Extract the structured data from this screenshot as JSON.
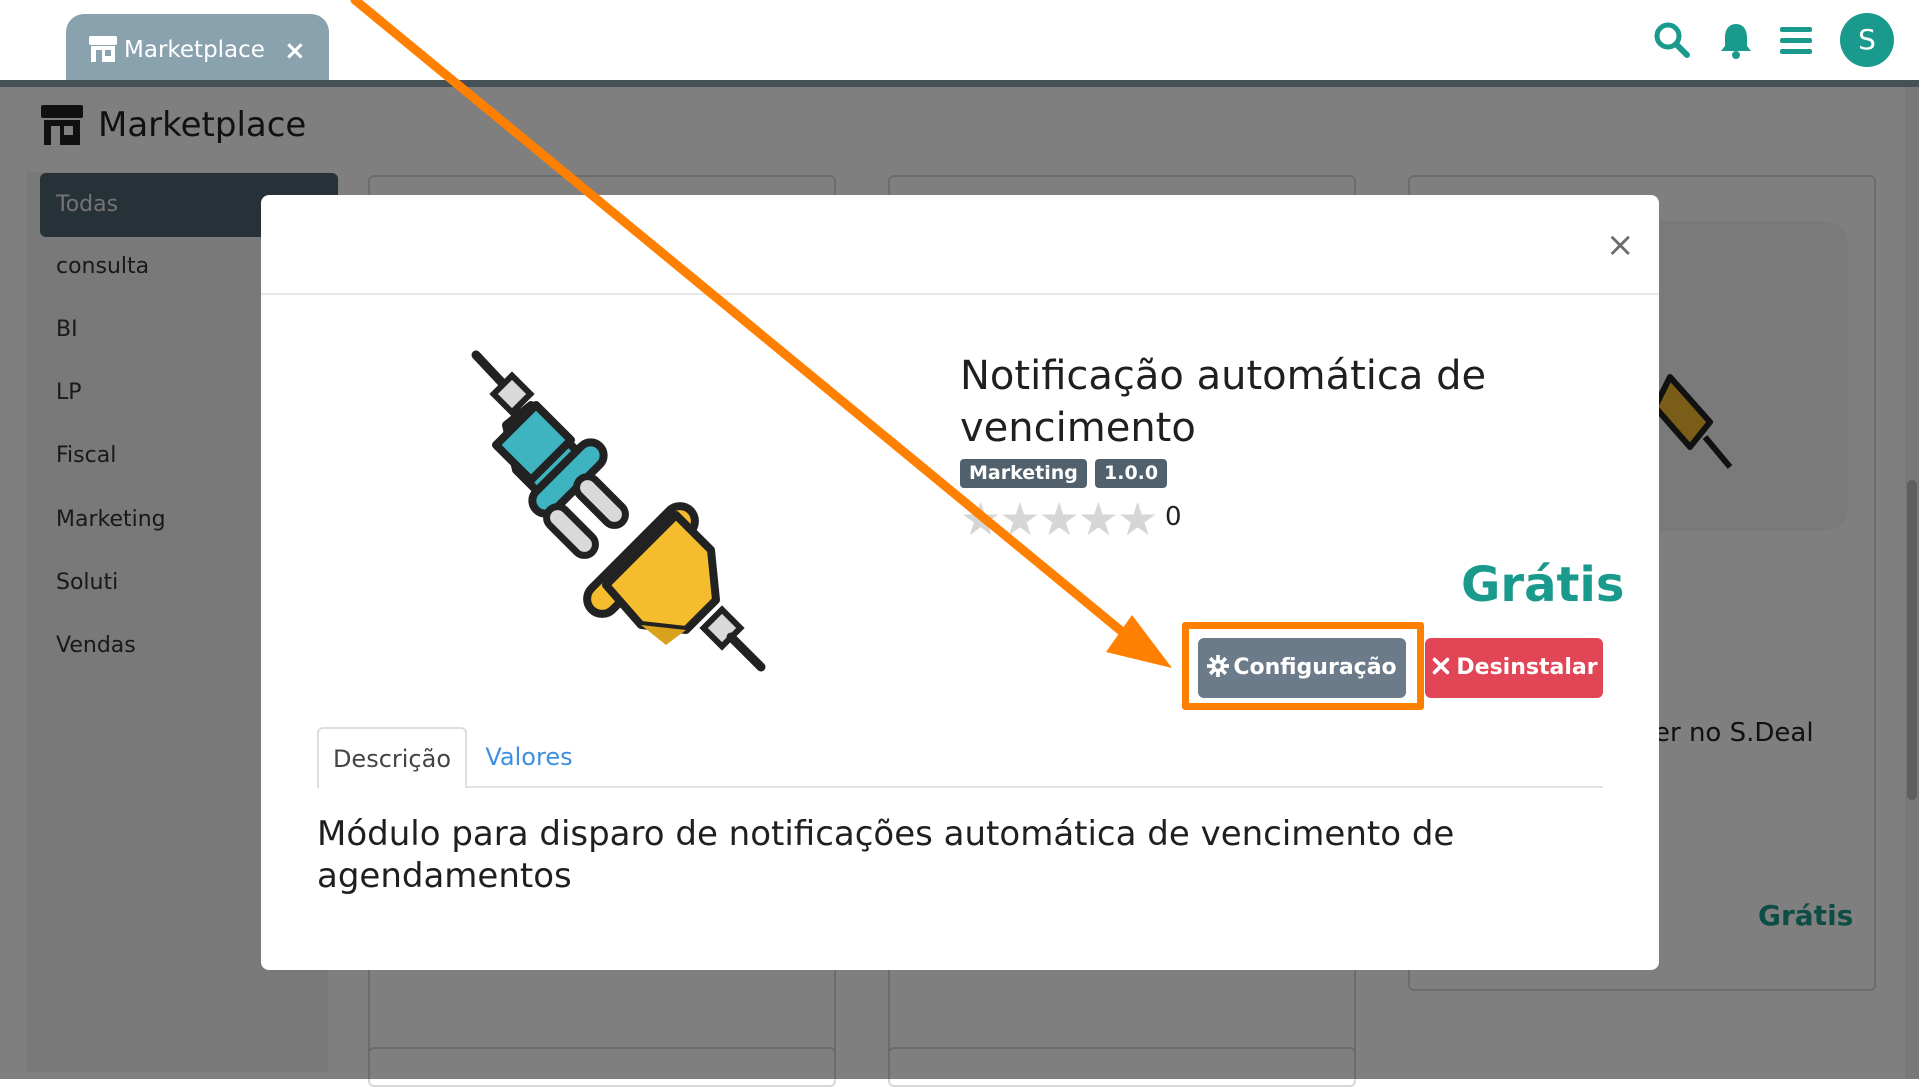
{
  "topbar": {
    "tab_label": "Marketplace",
    "tab_close": "×",
    "avatar_initial": "S",
    "icons": [
      "search-icon",
      "bell-icon",
      "menu-icon"
    ]
  },
  "page": {
    "title": "Marketplace",
    "categories": [
      "Todas",
      "consulta",
      "BI",
      "LP",
      "Fiscal",
      "Marketing",
      "Soluti",
      "Vendas"
    ],
    "active_category": "Todas",
    "bg_card_text": "er no S.Deal",
    "bg_card_price": "Grátis"
  },
  "modal": {
    "close": "×",
    "title": "Notificação automática de vencimento",
    "badges": [
      "Marketing",
      "1.0.0"
    ],
    "stars": "★★★★★",
    "rating_count": "0",
    "price": "Grátis",
    "config_button": "Configuração",
    "uninstall_button": "Desinstalar",
    "tabs": [
      "Descrição",
      "Valores"
    ],
    "description": "Módulo para disparo de notificações automática de vencimento de agendamentos"
  },
  "colors": {
    "accent": "#1a9a8c",
    "tab_bar": "#8aa1ae",
    "highlight": "#ff8000",
    "danger": "#e14556",
    "config": "#6c7b8a",
    "badge": "#50616d",
    "link": "#3f8fe0"
  }
}
